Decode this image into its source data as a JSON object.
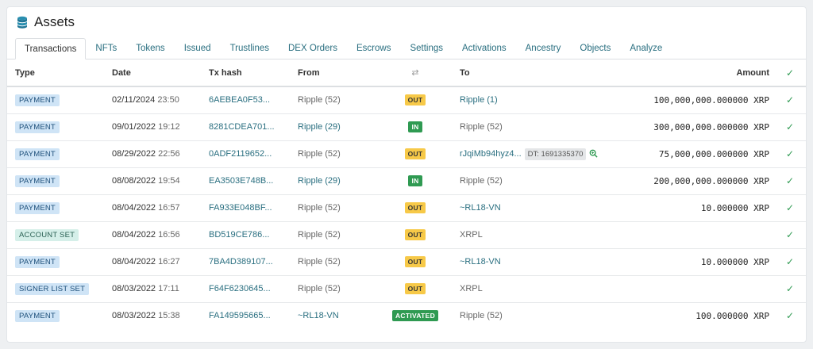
{
  "header": {
    "title": "Assets",
    "icon": "coins-stack-icon"
  },
  "tabs": [
    {
      "label": "Transactions",
      "active": true
    },
    {
      "label": "NFTs"
    },
    {
      "label": "Tokens"
    },
    {
      "label": "Issued"
    },
    {
      "label": "Trustlines"
    },
    {
      "label": "DEX Orders"
    },
    {
      "label": "Escrows"
    },
    {
      "label": "Settings"
    },
    {
      "label": "Activations"
    },
    {
      "label": "Ancestry"
    },
    {
      "label": "Objects"
    },
    {
      "label": "Analyze"
    }
  ],
  "columns": {
    "type": "Type",
    "date": "Date",
    "hash": "Tx hash",
    "from": "From",
    "direction_icon": "swap-arrows-icon",
    "to": "To",
    "amount": "Amount",
    "status_icon": "check-icon"
  },
  "rows": [
    {
      "type": "PAYMENT",
      "date": "02/11/2024",
      "time": "23:50",
      "hash": "6AEBEA0F53...",
      "from": "Ripple (52)",
      "from_link": false,
      "dir": "OUT",
      "to": "Ripple (1)",
      "to_link": true,
      "dt": "",
      "amount": "100,000,000.000000 XRP"
    },
    {
      "type": "PAYMENT",
      "date": "09/01/2022",
      "time": "19:12",
      "hash": "8281CDEA701...",
      "from": "Ripple (29)",
      "from_link": true,
      "dir": "IN",
      "to": "Ripple (52)",
      "to_link": false,
      "dt": "",
      "amount": "300,000,000.000000 XRP"
    },
    {
      "type": "PAYMENT",
      "date": "08/29/2022",
      "time": "22:56",
      "hash": "0ADF2119652...",
      "from": "Ripple (52)",
      "from_link": false,
      "dir": "OUT",
      "to": "rJqiMb94hyz4...",
      "to_link": true,
      "dt": "DT: 1691335370",
      "amount": "75,000,000.000000 XRP"
    },
    {
      "type": "PAYMENT",
      "date": "08/08/2022",
      "time": "19:54",
      "hash": "EA3503E748B...",
      "from": "Ripple (29)",
      "from_link": true,
      "dir": "IN",
      "to": "Ripple (52)",
      "to_link": false,
      "dt": "",
      "amount": "200,000,000.000000 XRP"
    },
    {
      "type": "PAYMENT",
      "date": "08/04/2022",
      "time": "16:57",
      "hash": "FA933E048BF...",
      "from": "Ripple (52)",
      "from_link": false,
      "dir": "OUT",
      "to": "~RL18-VN",
      "to_link": true,
      "dt": "",
      "amount": "10.000000 XRP"
    },
    {
      "type": "ACCOUNT SET",
      "date": "08/04/2022",
      "time": "16:56",
      "hash": "BD519CE786...",
      "from": "Ripple (52)",
      "from_link": false,
      "dir": "OUT",
      "to": "XRPL",
      "to_link": false,
      "dt": "",
      "amount": ""
    },
    {
      "type": "PAYMENT",
      "date": "08/04/2022",
      "time": "16:27",
      "hash": "7BA4D389107...",
      "from": "Ripple (52)",
      "from_link": false,
      "dir": "OUT",
      "to": "~RL18-VN",
      "to_link": true,
      "dt": "",
      "amount": "10.000000 XRP"
    },
    {
      "type": "SIGNER LIST SET",
      "date": "08/03/2022",
      "time": "17:11",
      "hash": "F64F6230645...",
      "from": "Ripple (52)",
      "from_link": false,
      "dir": "OUT",
      "to": "XRPL",
      "to_link": false,
      "dt": "",
      "amount": ""
    },
    {
      "type": "PAYMENT",
      "date": "08/03/2022",
      "time": "15:38",
      "hash": "FA149595665...",
      "from": "~RL18-VN",
      "from_link": true,
      "dir": "ACTIVATED",
      "to": "Ripple (52)",
      "to_link": false,
      "dt": "",
      "amount": "100.000000 XRP"
    }
  ],
  "colors": {
    "link": "#2a6f80",
    "out": "#f7c948",
    "in": "#2f9a52",
    "payment_badge": "#cfe4f6",
    "account_set_badge": "#d5efe9"
  }
}
